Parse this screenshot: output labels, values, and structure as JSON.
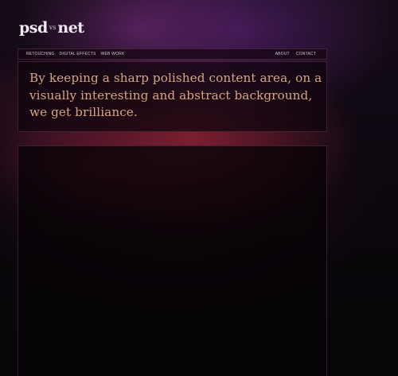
{
  "logo": {
    "part1": "psd",
    "vs": "vs",
    "part2": "net"
  },
  "nav": {
    "left": [
      {
        "label": "RETOUCHING"
      },
      {
        "label": "DIGITAL EFFECTS"
      },
      {
        "label": "WEB WORK"
      }
    ],
    "right": [
      {
        "label": "ABOUT"
      },
      {
        "label": "CONTACT"
      }
    ]
  },
  "intro": {
    "text": "By keeping a sharp polished content area, on a visually interesting and abstract background, we get brilliance."
  },
  "colors": {
    "intro_text": "#d8a682",
    "nav_text": "#d8c7d0",
    "logo": "#f1e9f1"
  }
}
